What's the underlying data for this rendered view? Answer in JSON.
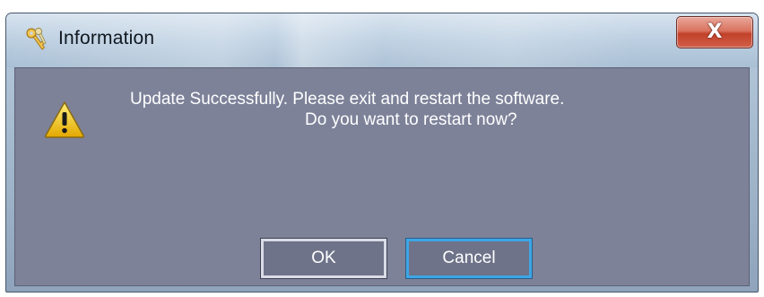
{
  "window": {
    "title": "Information",
    "app_icon": "keys-icon",
    "close_label": "X"
  },
  "dialog": {
    "icon": "warning-icon",
    "message_line1": "Update Successfully. Please exit and restart the software.",
    "message_line2": "Do you want to restart now?"
  },
  "buttons": {
    "ok_label": "OK",
    "cancel_label": "Cancel"
  },
  "colors": {
    "client_background": "#7d8299",
    "focus_border": "#3da6e6",
    "close_button": "#c2412a"
  }
}
